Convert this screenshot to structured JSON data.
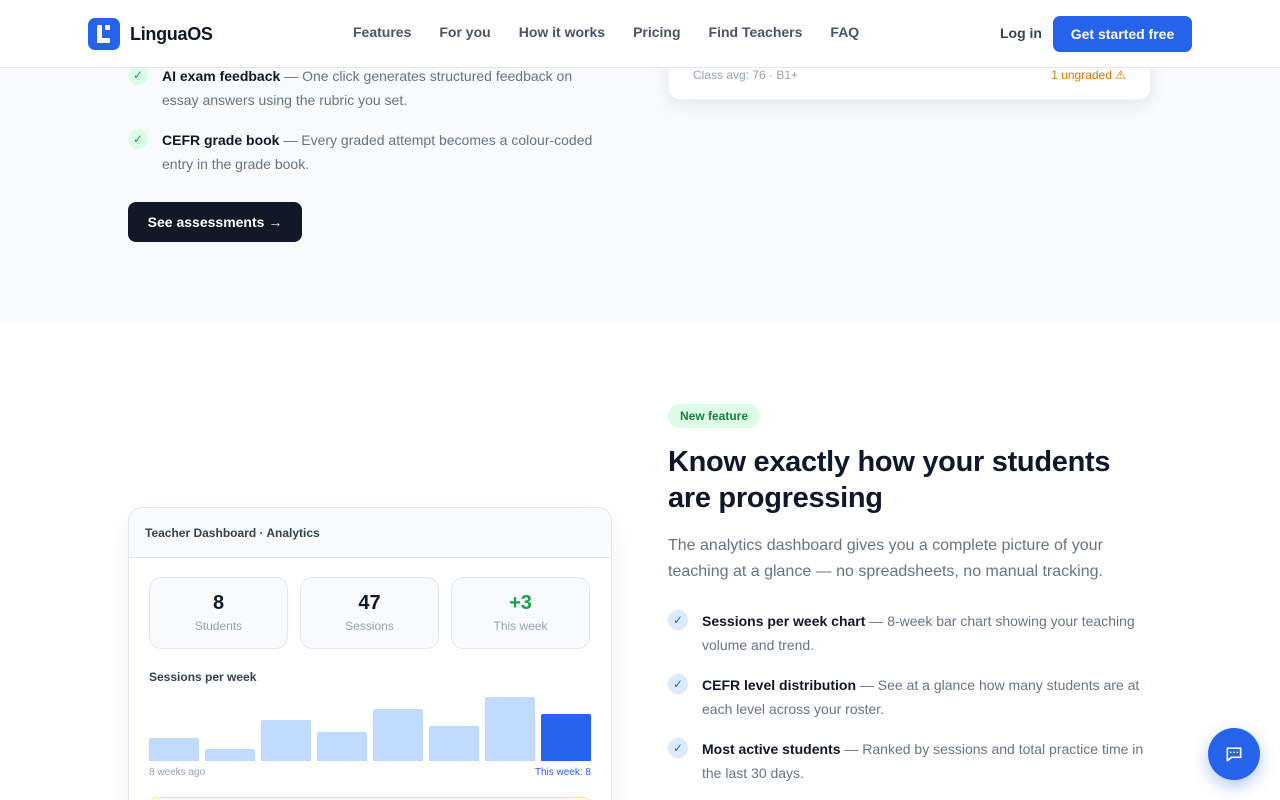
{
  "header": {
    "logo_text": "LinguaOS",
    "nav": [
      "Features",
      "For you",
      "How it works",
      "Pricing",
      "Find Teachers",
      "FAQ"
    ],
    "login": "Log in",
    "cta": "Get started free"
  },
  "top_section": {
    "features": [
      {
        "title": "AI exam feedback",
        "desc": " — One click generates structured feedback on essay answers using the rubric you set."
      },
      {
        "title": "CEFR grade book",
        "desc": " — Every graded attempt becomes a colour-coded entry in the grade book."
      }
    ],
    "button": "See assessments →",
    "card": {
      "class_avg": "Class avg: 76 · B1+",
      "ungraded": "1 ungraded ⚠"
    }
  },
  "dashboard": {
    "title": "Teacher Dashboard · Analytics",
    "stats": [
      {
        "value": "8",
        "label": "Students"
      },
      {
        "value": "47",
        "label": "Sessions"
      },
      {
        "value": "+3",
        "label": "This week"
      }
    ],
    "chart_title": "Sessions per week",
    "axis_start": "8 weeks ago",
    "axis_end": "This week: 8"
  },
  "chart_data": {
    "type": "bar",
    "title": "Sessions per week",
    "categories": [
      "",
      "",
      "",
      "",
      "",
      "",
      "",
      "This week"
    ],
    "values": [
      4,
      2,
      7,
      5,
      9,
      6,
      11,
      8
    ],
    "highlight_last": true,
    "colors": {
      "bar": "#bfdbfe",
      "current": "#2563eb"
    }
  },
  "analytics_section": {
    "badge": "New feature",
    "heading": "Know exactly how your students are progressing",
    "lead": "The analytics dashboard gives you a complete picture of your teaching at a glance — no spreadsheets, no manual tracking.",
    "features": [
      {
        "title": "Sessions per week chart",
        "desc": " — 8-week bar chart showing your teaching volume and trend."
      },
      {
        "title": "CEFR level distribution",
        "desc": " — See at a glance how many students are at each level across your roster."
      },
      {
        "title": "Most active students",
        "desc": " — Ranked by sessions and total practice time in the last 30 days."
      }
    ]
  },
  "icons": {
    "check": "check-icon",
    "chat": "chat-icon"
  },
  "colors": {
    "accent": "#2563eb",
    "dark": "#111827",
    "success": "#16a34a",
    "warning": "#d97706"
  }
}
